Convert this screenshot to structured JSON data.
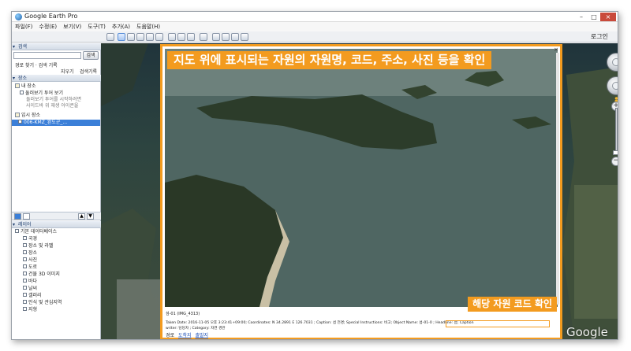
{
  "window": {
    "title": "Google Earth Pro",
    "controls": [
      "–",
      "□",
      "×"
    ]
  },
  "menu": {
    "items": [
      "파일(F)",
      "수정(E)",
      "보기(V)",
      "도구(T)",
      "추가(A)",
      "도움말(H)"
    ]
  },
  "toolbar": {
    "login_label": "로그인"
  },
  "sidebar": {
    "search_header": "검색",
    "search_button": "검색",
    "search_sub_left": "경로 찾기 · 검색 기록",
    "search_clear": "지우기",
    "search_history": "검색기록",
    "places_header": "장소",
    "places_items": [
      {
        "label": "내 장소",
        "style": "normal"
      },
      {
        "label": "둘러보기 투어 보기",
        "style": "normal"
      },
      {
        "label": "둘러보기 투어를 시작하려면",
        "style": "grey"
      },
      {
        "label": "사이드바 위 재생 아이콘을",
        "style": "grey"
      },
      {
        "label": "임시 장소",
        "style": "normal"
      },
      {
        "label": "006-KMZ_완도군_...",
        "style": "selected"
      }
    ],
    "layers_header": "레이어",
    "layer_items": [
      "기본 데이터베이스",
      "국경",
      "장소 및 라벨",
      "장소",
      "사진",
      "도로",
      "건물 3D 이미지",
      "바다",
      "날씨",
      "갤러리",
      "인식 및 관심지역",
      "지형"
    ]
  },
  "photo_panel": {
    "banner_main": "지도 위에 표시되는 자원의 자원명, 코드, 주소, 사진 등을 확인",
    "banner_code": "해당 자원 코드 확인",
    "file_name": "섬-01 (IMG_4313)",
    "caption_line_1": "Taken Date: 2016-11-05 오후 3:23:41+09:00; Coordinates: N 34.2891 E 126.7031 ; Caption: 섬 전경; Special Instructions: 비고; Object Name: 섬-01-0 ; Headline: 섬; Caption",
    "caption_line_2": "writer: 담당자 ; Category: 자연 경관",
    "links_prefix": "경로",
    "link_to": "도착지",
    "link_from": "출발지",
    "close": "×"
  },
  "map": {
    "logo": "Google Earth"
  },
  "nav": {
    "zoom_in": "+",
    "zoom_out": "−",
    "zoom_level": 0.9
  },
  "colors": {
    "accent": "#f39b1f",
    "selection": "#3b7fd8"
  }
}
